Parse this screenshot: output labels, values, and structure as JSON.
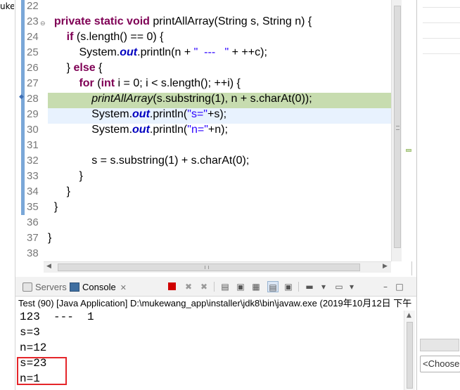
{
  "left_strip": {
    "cut_text": "uke"
  },
  "editor": {
    "line_numbers": [
      "22",
      "23",
      "24",
      "25",
      "26",
      "27",
      "28",
      "29",
      "30",
      "31",
      "32",
      "33",
      "34",
      "35",
      "36",
      "37",
      "38"
    ],
    "fold_marker_line": "23"
  },
  "console": {
    "tabs": [
      {
        "label": "Servers"
      },
      {
        "label": "Console"
      }
    ],
    "process_label": "Test (90) [Java Application] D:\\mukewang_app\\installer\\jdk8\\bin\\javaw.exe (2019年10月12日 下午",
    "output": [
      "123  ---  1",
      "s=3",
      "n=12",
      "s=23",
      "n=1"
    ]
  },
  "right_panel": {
    "combo_placeholder": "<Choose"
  },
  "colors": {
    "keyword": "#7f0055",
    "string": "#2a00ff",
    "field": "#0000c0",
    "current_line": "#e8f2fe",
    "debug_line": "#c7dcaf",
    "highlight_box": "#e5262a"
  },
  "icons": [
    "servers-icon",
    "console-icon",
    "terminate-icon",
    "remove-launch-icon",
    "remove-all-icon",
    "clear-console-icon",
    "scroll-lock-icon",
    "word-wrap-icon",
    "show-on-output-icon",
    "pin-console-icon",
    "display-console-icon",
    "open-console-icon",
    "minimize-icon",
    "maximize-icon"
  ]
}
